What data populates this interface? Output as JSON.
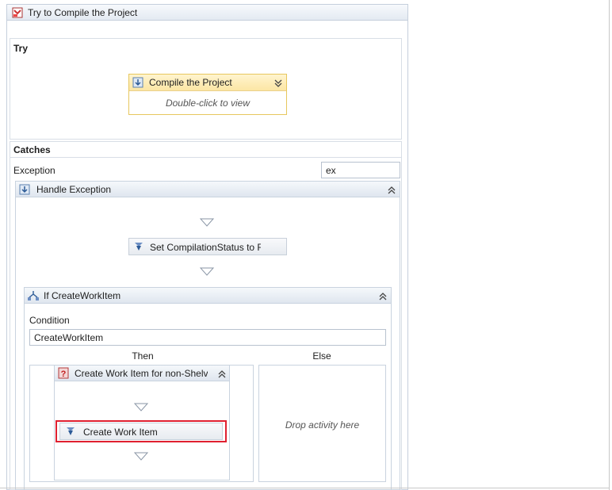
{
  "outer": {
    "title": "Try to Compile the Project",
    "icon": "try-catch-icon"
  },
  "try_section": {
    "label": "Try",
    "activity": {
      "title": "Compile the Project",
      "subtitle": "Double-click to view",
      "icon": "sequence-icon"
    }
  },
  "catches_section": {
    "label": "Catches",
    "exception_label": "Exception",
    "exception_variable": "ex",
    "handler": {
      "title": "Handle Exception",
      "icon": "sequence-icon",
      "set_activity": "Set CompilationStatus to F",
      "if_block": {
        "title": "If CreateWorkItem",
        "condition_label": "Condition",
        "condition_value": "CreateWorkItem",
        "then_label": "Then",
        "else_label": "Else",
        "then_sequence": {
          "title": "Create Work Item for non-Shelv",
          "activity": "Create Work Item"
        },
        "else_placeholder": "Drop activity here"
      }
    }
  },
  "colors": {
    "highlight_border": "#e02030",
    "compile_header": "#fce6a4",
    "header_gradient_end": "#e4eaf2"
  }
}
